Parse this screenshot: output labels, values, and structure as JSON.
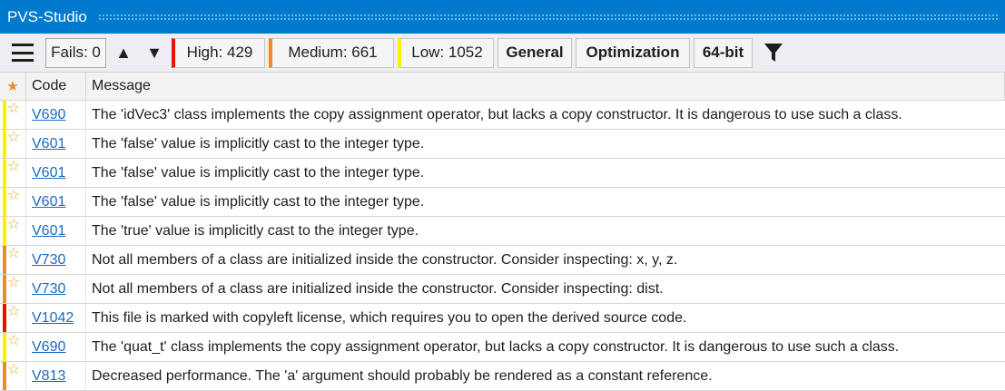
{
  "window": {
    "title": "PVS-Studio"
  },
  "toolbar": {
    "fails_label": "Fails: 0",
    "up_glyph": "▲",
    "down_glyph": "▼",
    "high_label": "High: 429",
    "medium_label": "Medium: 661",
    "low_label": "Low: 1052",
    "general_label": "General",
    "optimization_label": "Optimization",
    "bit64_label": "64-bit"
  },
  "colors": {
    "titlebar": "#007acc",
    "high": "#e51400",
    "medium": "#f08c1e",
    "low": "#fff200",
    "link": "#1a6cc4"
  },
  "grid": {
    "columns": {
      "star": "★",
      "code": "Code",
      "message": "Message"
    },
    "rows": [
      {
        "severity": "low",
        "code": "V690",
        "message": "The 'idVec3' class implements the copy assignment operator, but lacks a copy constructor. It is dangerous to use such a class."
      },
      {
        "severity": "low",
        "code": "V601",
        "message": "The 'false' value is implicitly cast to the integer type."
      },
      {
        "severity": "low",
        "code": "V601",
        "message": "The 'false' value is implicitly cast to the integer type."
      },
      {
        "severity": "low",
        "code": "V601",
        "message": "The 'false' value is implicitly cast to the integer type."
      },
      {
        "severity": "low",
        "code": "V601",
        "message": "The 'true' value is implicitly cast to the integer type."
      },
      {
        "severity": "medium",
        "code": "V730",
        "message": "Not all members of a class are initialized inside the constructor. Consider inspecting: x, y, z."
      },
      {
        "severity": "medium",
        "code": "V730",
        "message": "Not all members of a class are initialized inside the constructor. Consider inspecting: dist."
      },
      {
        "severity": "high",
        "code": "V1042",
        "message": "This file is marked with copyleft license, which requires you to open the derived source code."
      },
      {
        "severity": "low",
        "code": "V690",
        "message": "The 'quat_t' class implements the copy assignment operator, but lacks a copy constructor. It is dangerous to use such a class."
      },
      {
        "severity": "medium",
        "code": "V813",
        "message": "Decreased performance. The 'a' argument should probably be rendered as a constant reference."
      }
    ]
  }
}
